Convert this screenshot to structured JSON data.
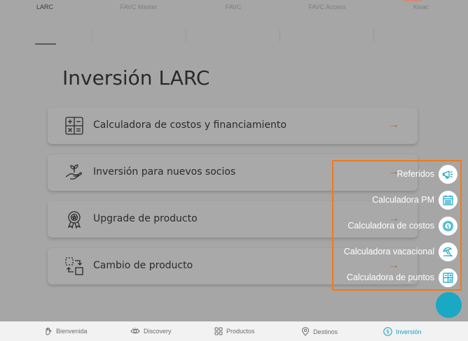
{
  "tabs": [
    "LARC",
    "FAVC Master",
    "FAVC",
    "FAVC Access",
    "Kivac"
  ],
  "active_tab": "LARC",
  "page_title": "Inversión LARC",
  "cards": [
    {
      "label": "Calculadora de costos y financiamiento",
      "icon": "calculator-icon"
    },
    {
      "label": "Inversión para nuevos socios",
      "icon": "hand-plant-icon"
    },
    {
      "label": "Upgrade de producto",
      "icon": "award-badge-icon"
    },
    {
      "label": "Cambio de producto",
      "icon": "swap-icon"
    }
  ],
  "arrow_glyph": "→",
  "fab_menu": [
    {
      "label": "Referidos",
      "icon": "megaphone-icon"
    },
    {
      "label": "Calculadora PM",
      "icon": "calendar-icon"
    },
    {
      "label": "Calculadora de costos",
      "icon": "dollar-coin-icon"
    },
    {
      "label": "Calculadora vacacional",
      "icon": "beach-umbrella-icon"
    },
    {
      "label": "Calculadora de puntos",
      "icon": "points-grid-icon"
    }
  ],
  "bottom_nav": [
    {
      "label": "Bienvenida",
      "icon": "hand-wave-icon"
    },
    {
      "label": "Discovery",
      "icon": "eye-icon"
    },
    {
      "label": "Productos",
      "icon": "grid-icon"
    },
    {
      "label": "Destinos",
      "icon": "map-pin-icon"
    },
    {
      "label": "Inversión",
      "icon": "dollar-circle-icon"
    }
  ],
  "active_nav": "Inversión",
  "colors": {
    "accent": "#13a3c4",
    "highlight_border": "#ef7a1a",
    "arrow": "#a3714d",
    "fab": "#1aa8c4"
  }
}
